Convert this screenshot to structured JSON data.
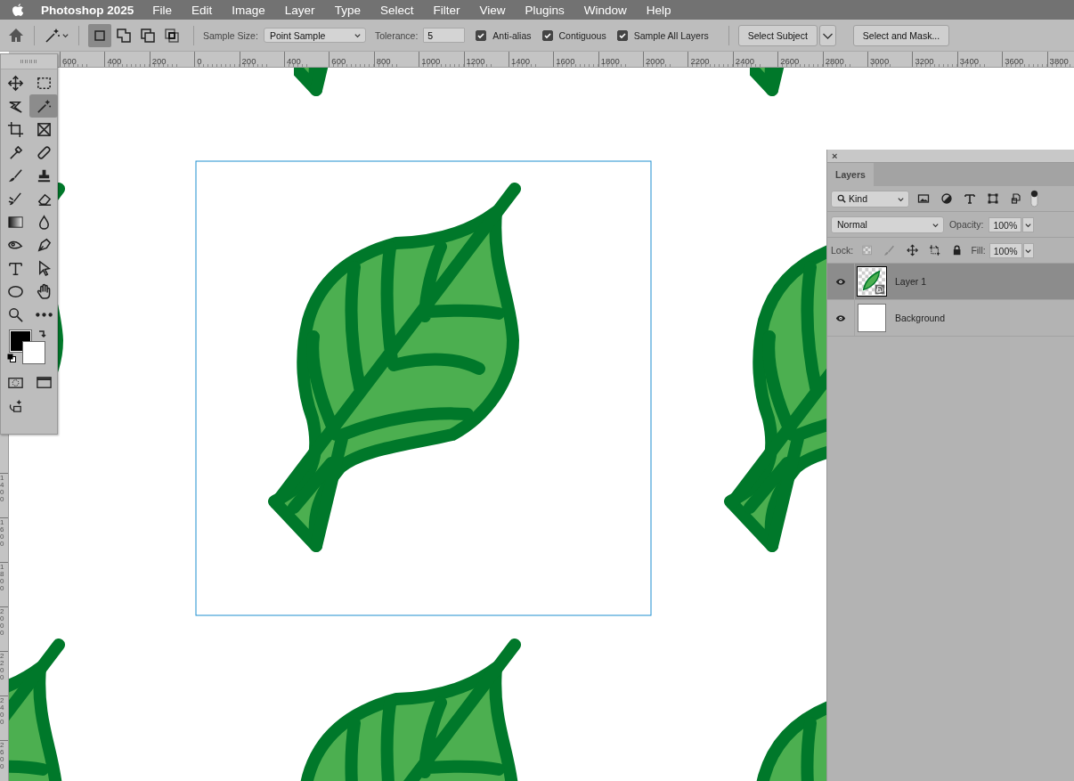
{
  "menu_bar": {
    "app_name": "Photoshop 2025",
    "items": [
      "File",
      "Edit",
      "Image",
      "Layer",
      "Type",
      "Select",
      "Filter",
      "View",
      "Plugins",
      "Window",
      "Help"
    ]
  },
  "options_bar": {
    "modes": [
      {
        "selected": true
      },
      {
        "selected": false
      },
      {
        "selected": false
      },
      {
        "selected": false
      }
    ],
    "sample_size_label": "Sample Size:",
    "sample_size": "Point Sample",
    "tolerance_label": "Tolerance:",
    "tolerance": "5",
    "checkboxes": [
      {
        "label": "Anti-alias",
        "checked": true
      },
      {
        "label": "Contiguous",
        "checked": true
      },
      {
        "label": "Sample All Layers",
        "checked": true
      }
    ],
    "buttons": [
      "Select Subject",
      "Select and Mask..."
    ]
  },
  "horizontal_ruler": [
    "600",
    "400",
    "200",
    "0",
    "200",
    "400",
    "600",
    "800",
    "1000",
    "1200",
    "1400",
    "1600",
    "1800",
    "2000",
    "2200",
    "2400",
    "2600",
    "2800",
    "3000",
    "3200",
    "3400",
    "3600",
    "3800"
  ],
  "vertical_ruler": [
    "1400",
    "1600",
    "1800",
    "2000",
    "2200",
    "2400",
    "2600"
  ],
  "toolbar": {
    "tools": [
      {
        "selected": false
      },
      {
        "selected": false
      },
      {
        "selected": false
      },
      {
        "selected": true
      },
      {
        "selected": false
      },
      {
        "selected": false
      },
      {
        "selected": false
      },
      {
        "selected": false
      },
      {
        "selected": false
      },
      {
        "selected": false
      },
      {
        "selected": false
      },
      {
        "selected": false
      },
      {
        "selected": false
      },
      {
        "selected": false
      },
      {
        "selected": false
      },
      {
        "selected": false
      },
      {
        "selected": false
      },
      {
        "selected": false
      },
      {
        "selected": false
      },
      {
        "selected": false
      },
      {
        "selected": false
      },
      {
        "selected": false
      }
    ]
  },
  "layers_panel": {
    "close": "×",
    "tabs": [
      {
        "label": "Layers",
        "selected": true
      }
    ],
    "filter": "Kind",
    "blend_mode": "Normal",
    "opacity_label": "Opacity:",
    "opacity": "100%",
    "lock_label": "Lock:",
    "fill_label": "Fill:",
    "fill": "100%",
    "layers": [
      {
        "name": "Layer 1",
        "kind": "smart",
        "selected": true,
        "visible": true
      },
      {
        "name": "Background",
        "kind": "plain",
        "selected": false,
        "visible": true
      }
    ]
  }
}
